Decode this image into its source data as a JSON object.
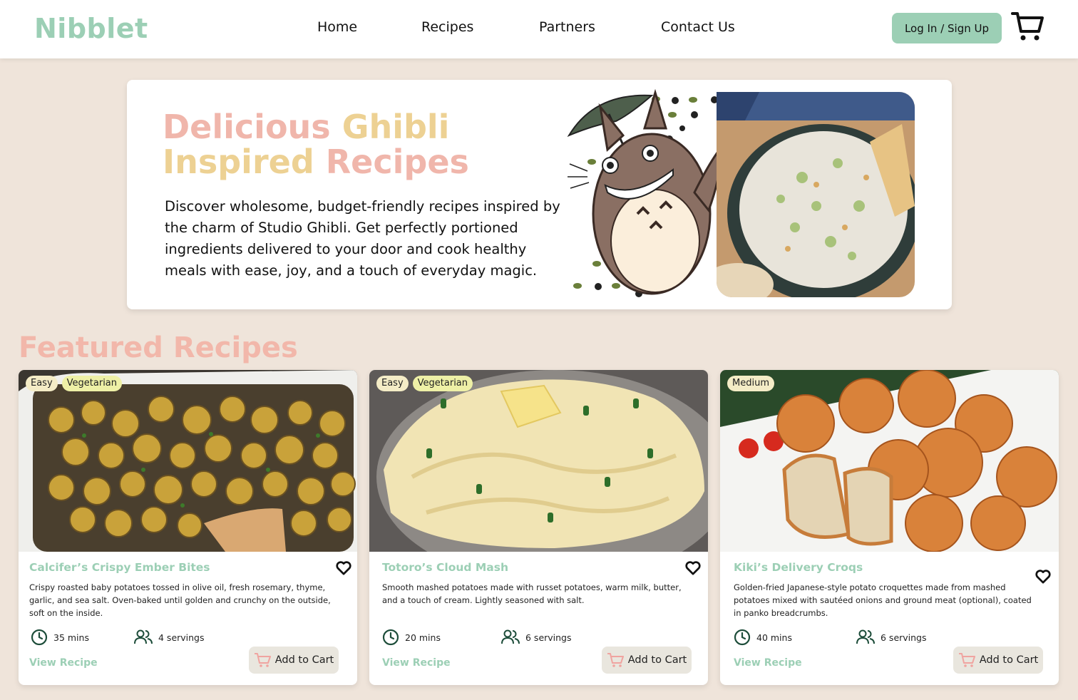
{
  "brand": {
    "logo": "Nibblet",
    "accent": "#9ccfb5",
    "pink": "#f2b7aa",
    "gold": "#edd193",
    "background": "#efe4da"
  },
  "nav": {
    "items": [
      {
        "label": "Home"
      },
      {
        "label": "Recipes"
      },
      {
        "label": "Partners"
      },
      {
        "label": "Contact Us"
      }
    ],
    "login_label": "Log In / Sign Up",
    "cart_icon": "shopping-cart-icon"
  },
  "hero": {
    "title_part1": "Delicious",
    "title_part2": "Ghibli",
    "title_part3": "Inspired",
    "title_part4": "Recipes",
    "description": "Discover wholesome, budget-friendly recipes inspired by the charm of Studio Ghibli. Get perfectly portioned ingredients delivered to your door and cook healthy meals with ease, joy, and a touch of everyday magic."
  },
  "featured": {
    "title": "Featured Recipes",
    "recipes": [
      {
        "tags": [
          "Easy",
          "Vegetarian"
        ],
        "title": "Calcifer’s Crispy Ember Bites",
        "description": "Crispy roasted baby potatoes tossed in olive oil, fresh rosemary, thyme, garlic, and sea salt. Oven-baked until golden and crunchy on the outside, soft on the inside.",
        "time": "35 mins",
        "servings": "4 servings",
        "view_label": "View Recipe",
        "cart_label": "Add to Cart"
      },
      {
        "tags": [
          "Easy",
          "Vegetarian"
        ],
        "title": "Totoro’s Cloud Mash",
        "description": "Smooth mashed potatoes made with russet potatoes, warm milk, butter, and a touch of cream. Lightly seasoned with salt.",
        "time": "20 mins",
        "servings": "6 servings",
        "view_label": "View Recipe",
        "cart_label": "Add to Cart"
      },
      {
        "tags": [
          "Medium"
        ],
        "title": "Kiki’s Delivery Croqs",
        "description": "Golden-fried Japanese-style potato croquettes made from mashed potatoes mixed with sautéed onions and ground meat (optional), coated in panko breadcrumbs.",
        "time": "40 mins",
        "servings": "6 servings",
        "view_label": "View Recipe",
        "cart_label": "Add to Cart"
      }
    ]
  }
}
